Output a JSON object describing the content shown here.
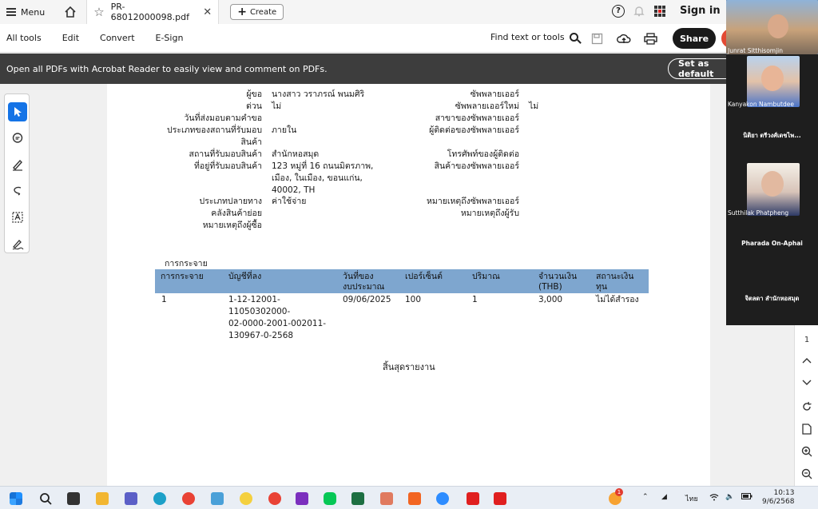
{
  "tabbar": {
    "menu_label": "Menu",
    "tab_title": "PR-68012000098.pdf",
    "create_label": "Create",
    "signin_label": "Sign in"
  },
  "toolbar": {
    "all_tools": "All tools",
    "edit": "Edit",
    "convert": "Convert",
    "esign": "E-Sign",
    "find": "Find text or tools",
    "share": "Share"
  },
  "banner": {
    "message": "Open all PDFs with Acrobat Reader to easily view and comment on PDFs.",
    "set_default": "Set as default"
  },
  "document": {
    "left_labels": {
      "requester": "ผู้ขอ",
      "urgent": "ด่วน",
      "delivery_date": "วันที่ส่งมอบตามคำขอ",
      "location_type": "ประเภทของสถานที่รับมอบ\nสินค้า",
      "location": "สถานที่รับมอบสินค้า",
      "address": "ที่อยู่ที่รับมอบสินค้า",
      "dest_type": "ประเภทปลายทาง",
      "sub_warehouse": "คลังสินค้าย่อย",
      "buyer_note": "หมายเหตุถึงผู้ซื้อ"
    },
    "left_values": {
      "requester": "นางสาว วราภรณ์ พนมศิริ",
      "urgent": "ไม่",
      "location_type": "ภายใน",
      "location": "สำนักหอสมุด",
      "address": "123 หมู่ที่ 16 ถนนมิตรภาพ,\nเมือง, ในเมือง, ขอนแก่น,\n40002, TH",
      "dest_type": "ค่าใช้จ่าย"
    },
    "right_labels": {
      "supplier": "ซัพพลายเออร์",
      "new_supplier": "ซัพพลายเออร์ใหม่",
      "supplier_branch": "สาขาของซัพพลายเออร์",
      "supplier_contact": "ผู้ติดต่อของซัพพลายเออร์",
      "contact_phone": "โทรศัพท์ของผู้ติดต่อ\nสินค้าของซัพพลายเออร์",
      "supplier_note": "หมายเหตุถึงซัพพลายเออร์",
      "receiver_note": "หมายเหตุถึงผู้รับ"
    },
    "right_values": {
      "new_supplier": "ไม่"
    },
    "distribution_title": "การกระจาย",
    "table_headers": [
      "การกระจาย",
      "บัญชีที่ลง",
      "วันที่ของ\nงบประมาณ",
      "เปอร์เซ็นต์",
      "ปริมาณ",
      "จำนวนเงิน\n(THB)",
      "สถานะเงิน\nทุน"
    ],
    "table_row": [
      "1",
      "1-12-12001-11050302000-\n02-0000-2001-002011-\n130967-0-2568",
      "09/06/2025",
      "100",
      "1",
      "3,000",
      "ไม่ได้สำรอง"
    ],
    "end_of_report": "สิ้นสุดรายงาน"
  },
  "page_nav": {
    "page_number": "1"
  },
  "video": {
    "participants": [
      "Junrat Sitthisomjin",
      "Kanyakon Nambutdee",
      "นิติยา ตรีวงศ์เดชไพ...",
      "Sutthilak Phatpheng",
      "Pharada On-Aphai",
      "จิตลดา สำนักหอสมุด"
    ]
  },
  "taskbar": {
    "lang": "ไทย",
    "time": "10:13",
    "date": "9/6/2568",
    "notification_count": "1"
  }
}
